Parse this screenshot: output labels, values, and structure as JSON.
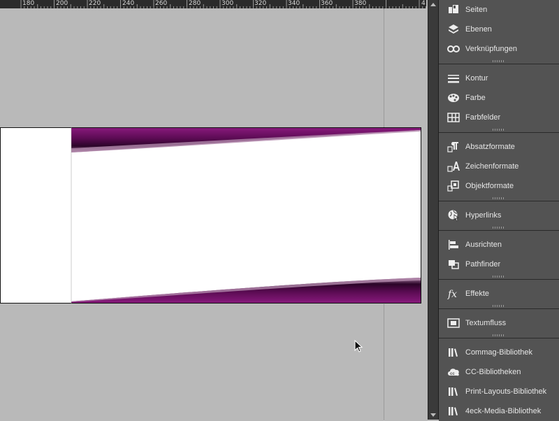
{
  "ruler": {
    "ticks": [
      "180",
      "200",
      "220",
      "240",
      "260",
      "280",
      "300",
      "320",
      "340",
      "360",
      "380",
      "4"
    ]
  },
  "panel": {
    "groups": [
      {
        "items": [
          {
            "label": "Seiten",
            "icon": "pages-icon"
          },
          {
            "label": "Ebenen",
            "icon": "layers-icon"
          },
          {
            "label": "Verknüpfungen",
            "icon": "links-icon"
          }
        ]
      },
      {
        "items": [
          {
            "label": "Kontur",
            "icon": "stroke-icon"
          },
          {
            "label": "Farbe",
            "icon": "palette-icon"
          },
          {
            "label": "Farbfelder",
            "icon": "swatches-icon"
          }
        ]
      },
      {
        "items": [
          {
            "label": "Absatzformate",
            "icon": "paragraph-styles-icon"
          },
          {
            "label": "Zeichenformate",
            "icon": "character-styles-icon"
          },
          {
            "label": "Objektformate",
            "icon": "object-styles-icon"
          }
        ]
      },
      {
        "items": [
          {
            "label": "Hyperlinks",
            "icon": "hyperlinks-icon"
          }
        ]
      },
      {
        "items": [
          {
            "label": "Ausrichten",
            "icon": "align-icon"
          },
          {
            "label": "Pathfinder",
            "icon": "pathfinder-icon"
          }
        ]
      },
      {
        "items": [
          {
            "label": "Effekte",
            "icon": "effects-icon"
          }
        ]
      },
      {
        "items": [
          {
            "label": "Textumfluss",
            "icon": "text-wrap-icon"
          }
        ]
      },
      {
        "items": [
          {
            "label": "Commag-Bibliothek",
            "icon": "library-icon"
          },
          {
            "label": "CC-Bibliotheken",
            "icon": "cc-libraries-icon"
          },
          {
            "label": "Print-Layouts-Bibliothek",
            "icon": "library-icon"
          },
          {
            "label": "4eck-Media-Bibliothek",
            "icon": "library-icon"
          }
        ]
      }
    ]
  },
  "colors": {
    "accent": "#7a0f6e",
    "accent_dark": "#2b0428",
    "panel_bg": "#535353",
    "canvas_bg": "#b9b9b9"
  }
}
